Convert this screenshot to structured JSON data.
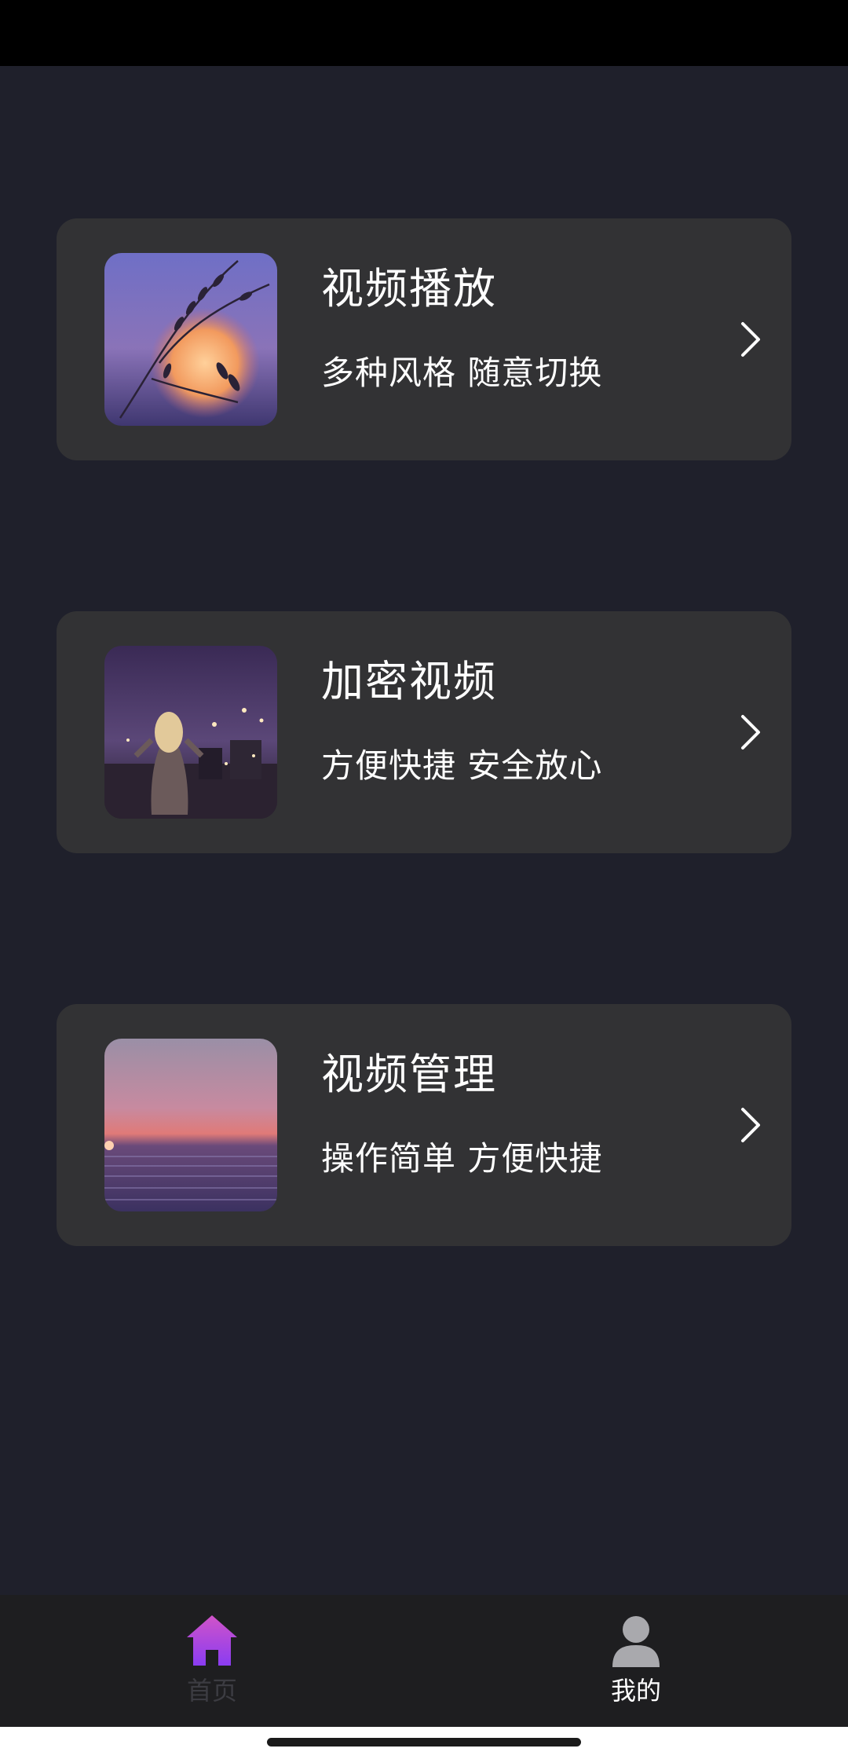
{
  "cards": [
    {
      "title": "视频播放",
      "subtitle": "多种风格 随意切换",
      "image": "grass-sunset-photo"
    },
    {
      "title": "加密视频",
      "subtitle": "方便快捷 安全放心",
      "image": "woman-city-night-photo"
    },
    {
      "title": "视频管理",
      "subtitle": "操作简单 方便快捷",
      "image": "sea-sunset-photo"
    }
  ],
  "tabbar": {
    "home_label": "首页",
    "mine_label": "我的",
    "home_icon": "house-icon",
    "mine_icon": "person-icon",
    "accent": "#a641f0"
  },
  "colors": {
    "background": "#1f202b",
    "card": "#323234",
    "tabbar": "#1e1e20"
  }
}
